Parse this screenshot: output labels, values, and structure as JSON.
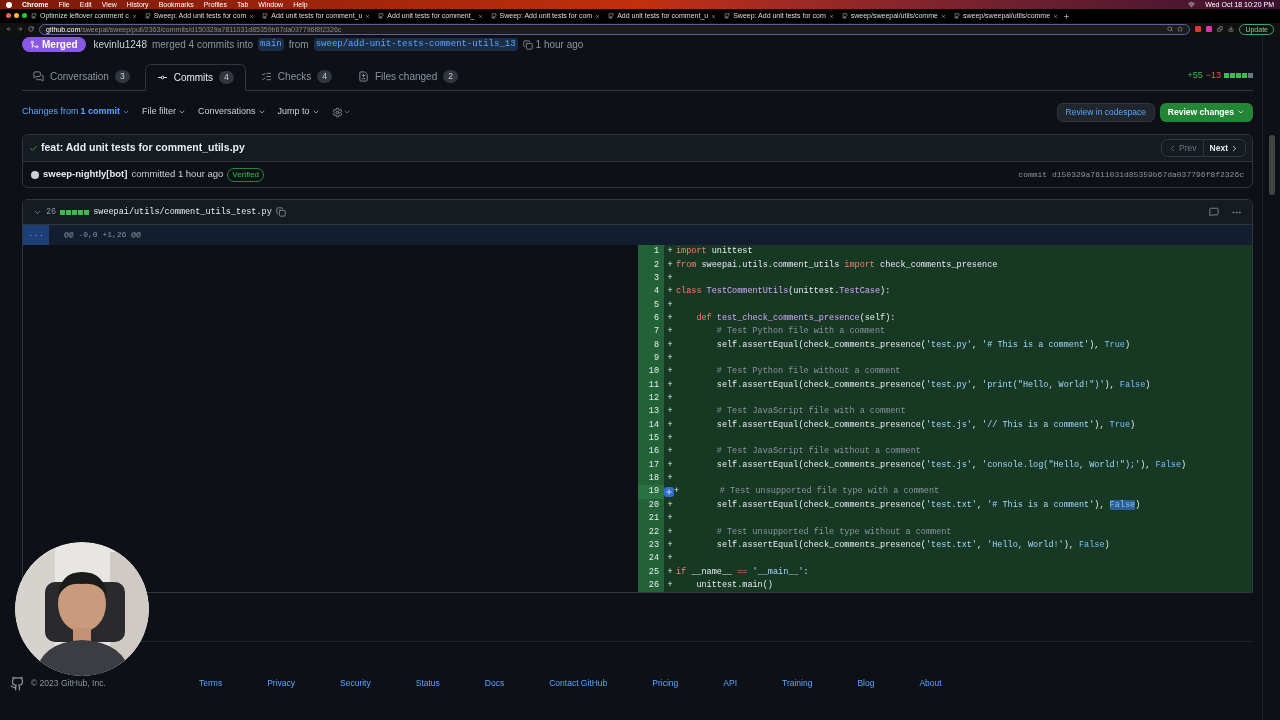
{
  "menu_bar": {
    "items": [
      "Chrome",
      "File",
      "Edit",
      "View",
      "History",
      "Bookmarks",
      "Profiles",
      "Tab",
      "Window",
      "Help"
    ],
    "clock": "Wed Oct 18  10:20 PM"
  },
  "browser": {
    "tabs": [
      "Optimize leftover comment c",
      "Sweep: Add unit tests for com",
      "Add unit tests for comment_u",
      "Add unit tests for comment_",
      "Sweep: Add unit tests for com",
      "Add unit tests for comment_u",
      "Sweep: Add unit tests for com",
      "sweep/sweepai/utils/comme",
      "sweep/sweepai/utils/comme"
    ],
    "url_host": "github.com",
    "url_path": "/sweepai/sweep/pull/2363/commits/d150329a7811031d85359b67da037796f8f2326c",
    "update_button": "Update"
  },
  "pr": {
    "state": "Merged",
    "author": "kevinlu1248",
    "action": "merged 4 commits into",
    "base": "main",
    "from": "from",
    "head": "sweep/add-unit-tests-comment-utils_13",
    "time": "1 hour ago"
  },
  "tabs": [
    {
      "label": "Conversation",
      "count": "3",
      "selected": false
    },
    {
      "label": "Commits",
      "count": "4",
      "selected": true
    },
    {
      "label": "Checks",
      "count": "4",
      "selected": false
    },
    {
      "label": "Files changed",
      "count": "2",
      "selected": false
    }
  ],
  "diffstat": {
    "added": "+55",
    "removed": "−13"
  },
  "toolbar": {
    "changes_from": "Changes from",
    "commit_count": "1 commit",
    "filters": [
      "File filter",
      "Conversations",
      "Jump to"
    ],
    "codespace_button": "Review in codespace",
    "review_button": "Review changes"
  },
  "commit": {
    "title": "feat: Add unit tests for comment_utils.py",
    "author": "sweep-nightly[bot]",
    "committed": "committed 1 hour ago",
    "badge": "Verified",
    "prev": "Prev",
    "next": "Next",
    "sha": "commit d150329a7811031d85359b67da037796f8f2326c"
  },
  "file": {
    "changes": "26",
    "path": "sweepai/utils/comment_utils_test.py",
    "expand": "...",
    "hunk": "@@ -0,0 +1,26 @@",
    "lines": [
      {
        "n": "1",
        "sign": "+",
        "hover": false,
        "tokens": [
          {
            "kind": "kw",
            "text": "import"
          },
          {
            "kind": "plain",
            "text": " unittest"
          }
        ]
      },
      {
        "n": "2",
        "sign": "+",
        "hover": false,
        "tokens": [
          {
            "kind": "kw",
            "text": "from"
          },
          {
            "kind": "plain",
            "text": " sweepai.utils.comment_utils "
          },
          {
            "kind": "kw",
            "text": "import"
          },
          {
            "kind": "plain",
            "text": " check_comments_presence"
          }
        ]
      },
      {
        "n": "3",
        "sign": "+",
        "hover": false
      },
      {
        "n": "4",
        "sign": "+",
        "hover": false,
        "tokens": [
          {
            "kind": "kw",
            "text": "class"
          },
          {
            "kind": "cls",
            "text": " TestCommentUtils"
          },
          {
            "kind": "plain",
            "text": "(unittest."
          },
          {
            "kind": "cls",
            "text": "TestCase"
          },
          {
            "kind": "plain",
            "text": "):"
          }
        ]
      },
      {
        "n": "5",
        "sign": "+",
        "hover": false
      },
      {
        "n": "6",
        "sign": "+",
        "hover": false,
        "tokens": [
          {
            "kind": "kw",
            "text": "    def"
          },
          {
            "kind": "fn",
            "text": " test_check_comments_presence"
          },
          {
            "kind": "plain",
            "text": "(self):"
          }
        ]
      },
      {
        "n": "7",
        "sign": "+",
        "hover": false,
        "tokens": [
          {
            "kind": "com",
            "text": "        # Test Python file with a comment"
          }
        ]
      },
      {
        "n": "8",
        "sign": "+",
        "hover": false,
        "tokens": [
          {
            "kind": "plain",
            "text": "        self.assertEqual(check_comments_presence("
          },
          {
            "kind": "str",
            "text": "'test.py'"
          },
          {
            "kind": "plain",
            "text": ", "
          },
          {
            "kind": "str",
            "text": "'# This is a comment'"
          },
          {
            "kind": "plain",
            "text": "), "
          },
          {
            "kind": "const",
            "text": "True"
          },
          {
            "kind": "plain",
            "text": ")"
          }
        ]
      },
      {
        "n": "9",
        "sign": "+",
        "hover": false
      },
      {
        "n": "10",
        "sign": "+",
        "hover": false,
        "tokens": [
          {
            "kind": "com",
            "text": "        # Test Python file without a comment"
          }
        ]
      },
      {
        "n": "11",
        "sign": "+",
        "hover": false,
        "tokens": [
          {
            "kind": "plain",
            "text": "        self.assertEqual(check_comments_presence("
          },
          {
            "kind": "str",
            "text": "'test.py'"
          },
          {
            "kind": "plain",
            "text": ", "
          },
          {
            "kind": "str",
            "text": "'print(\"Hello, World!\")'"
          },
          {
            "kind": "plain",
            "text": "), "
          },
          {
            "kind": "const",
            "text": "False"
          },
          {
            "kind": "plain",
            "text": ")"
          }
        ]
      },
      {
        "n": "12",
        "sign": "+",
        "hover": false
      },
      {
        "n": "13",
        "sign": "+",
        "hover": false,
        "tokens": [
          {
            "kind": "com",
            "text": "        # Test JavaScript file with a comment"
          }
        ]
      },
      {
        "n": "14",
        "sign": "+",
        "hover": false,
        "tokens": [
          {
            "kind": "plain",
            "text": "        self.assertEqual(check_comments_presence("
          },
          {
            "kind": "str",
            "text": "'test.js'"
          },
          {
            "kind": "plain",
            "text": ", "
          },
          {
            "kind": "str",
            "text": "'// This is a comment'"
          },
          {
            "kind": "plain",
            "text": "), "
          },
          {
            "kind": "const",
            "text": "True"
          },
          {
            "kind": "plain",
            "text": ")"
          }
        ]
      },
      {
        "n": "15",
        "sign": "+",
        "hover": false
      },
      {
        "n": "16",
        "sign": "+",
        "hover": false,
        "tokens": [
          {
            "kind": "com",
            "text": "        # Test JavaScript file without a comment"
          }
        ]
      },
      {
        "n": "17",
        "sign": "+",
        "hover": false,
        "tokens": [
          {
            "kind": "plain",
            "text": "        self.assertEqual(check_comments_presence("
          },
          {
            "kind": "str",
            "text": "'test.js'"
          },
          {
            "kind": "plain",
            "text": ", "
          },
          {
            "kind": "str",
            "text": "'console.log(\"Hello, World!\");'"
          },
          {
            "kind": "plain",
            "text": "), "
          },
          {
            "kind": "const",
            "text": "False"
          },
          {
            "kind": "plain",
            "text": ")"
          }
        ]
      },
      {
        "n": "18",
        "sign": "+",
        "hover": false
      },
      {
        "n": "19",
        "sign": "+",
        "hover": true,
        "tokens": [
          {
            "kind": "com",
            "text": "        # Test unsupported file type with a comment"
          }
        ]
      },
      {
        "n": "20",
        "sign": "+",
        "hover": false,
        "tokens": [
          {
            "kind": "plain",
            "text": "        self.assertEqual(check_comments_presence("
          },
          {
            "kind": "str",
            "text": "'test.txt'"
          },
          {
            "kind": "plain",
            "text": ", "
          },
          {
            "kind": "str",
            "text": "'# This is a comment'"
          },
          {
            "kind": "plain",
            "text": "), "
          },
          {
            "kind": "selection",
            "text": "False"
          },
          {
            "kind": "plain",
            "text": ")"
          }
        ]
      },
      {
        "n": "21",
        "sign": "+",
        "hover": false
      },
      {
        "n": "22",
        "sign": "+",
        "hover": false,
        "tokens": [
          {
            "kind": "com",
            "text": "        # Test unsupported file type without a comment"
          }
        ]
      },
      {
        "n": "23",
        "sign": "+",
        "hover": false,
        "tokens": [
          {
            "kind": "plain",
            "text": "        self.assertEqual(check_comments_presence("
          },
          {
            "kind": "str",
            "text": "'test.txt'"
          },
          {
            "kind": "plain",
            "text": ", "
          },
          {
            "kind": "str",
            "text": "'Hello, World!'"
          },
          {
            "kind": "plain",
            "text": "), "
          },
          {
            "kind": "const",
            "text": "False"
          },
          {
            "kind": "plain",
            "text": ")"
          }
        ]
      },
      {
        "n": "24",
        "sign": "+",
        "hover": false
      },
      {
        "n": "25",
        "sign": "+",
        "hover": false,
        "tokens": [
          {
            "kind": "kw",
            "text": "if"
          },
          {
            "kind": "plain",
            "text": " __name__ "
          },
          {
            "kind": "kw",
            "text": "=="
          },
          {
            "kind": "str",
            "text": " '__main__'"
          },
          {
            "kind": "plain",
            "text": ":"
          }
        ]
      },
      {
        "n": "26",
        "sign": "+",
        "hover": false,
        "tokens": [
          {
            "kind": "plain",
            "text": "    unittest.main()"
          }
        ]
      }
    ]
  },
  "footer": {
    "copyright": "© 2023 GitHub, Inc.",
    "links": [
      "Terms",
      "Privacy",
      "Security",
      "Status",
      "Docs",
      "Contact GitHub",
      "Pricing",
      "API",
      "Training",
      "Blog",
      "About"
    ]
  }
}
